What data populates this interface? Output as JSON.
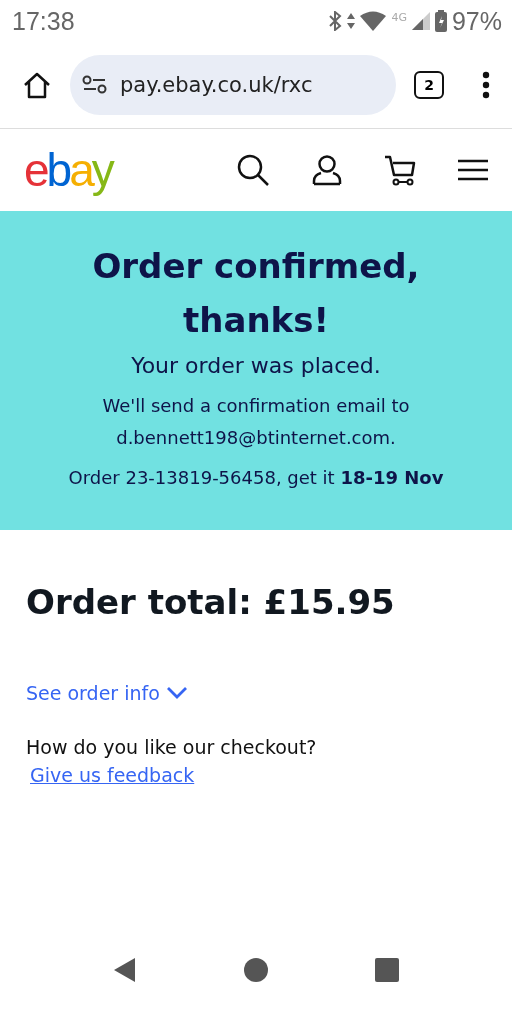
{
  "status_bar": {
    "time": "17:38",
    "network": "4G",
    "battery": "97%"
  },
  "browser": {
    "url": "pay.ebay.co.uk/rxc",
    "tab_count": "2"
  },
  "logo": [
    {
      "letter": "e",
      "color": "#e53238"
    },
    {
      "letter": "b",
      "color": "#0064d2"
    },
    {
      "letter": "a",
      "color": "#f5af02"
    },
    {
      "letter": "y",
      "color": "#86b817"
    }
  ],
  "banner": {
    "title": "Order confirmed, thanks!",
    "subtitle": "Your order was placed.",
    "email_note": "We'll send a confirmation email to d.bennett198@btinternet.com.",
    "order_line": "Order 23-13819-56458, get it **18-19 Nov**"
  },
  "order_total": "Order total: £15.95",
  "order_info_link": {
    "label": "See order info",
    "expanded": false
  },
  "feedback": {
    "question": "How do you like our checkout?",
    "link": "Give us feedback"
  }
}
